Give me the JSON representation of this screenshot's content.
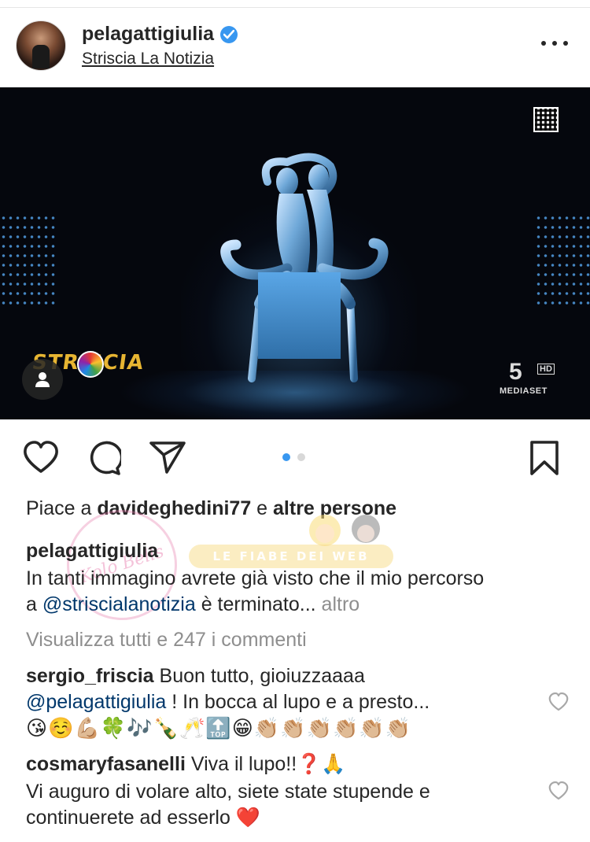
{
  "header": {
    "username": "pelagattigiulia",
    "location": "Striscia La Notizia",
    "verified": true
  },
  "media": {
    "carousel_total": 2,
    "carousel_active": 1,
    "overlay_logo": "STRISCIA",
    "broadcaster_logo": "5",
    "broadcaster_hd": "HD",
    "broadcaster_name": "MEDIASET"
  },
  "likes": {
    "prefix": "Piace a ",
    "user": "davideghedini77",
    "middle": " e ",
    "others": "altre persone"
  },
  "caption": {
    "user": "pelagattigiulia",
    "line1": "In tanti immagino avrete già visto che il mio percorso",
    "line2_prefix": "a ",
    "mention": "@striscialanotizia",
    "line2_suffix": " è terminato... ",
    "more": "altro"
  },
  "view_all_comments": "Visualizza tutti e 247 i commenti",
  "comments": [
    {
      "user": "sergio_friscia",
      "text1": " Buon tutto, gioiuzzaaaa",
      "mention": "@pelagattigiulia",
      "text2": " ! In bocca al lupo e a presto...",
      "emoji_line": "😘☺️💪🏼🍀🎶🍾🥂🔝😁👏🏼👏🏼👏🏼👏🏼👏🏼👏🏼"
    },
    {
      "user": "cosmaryfasanelli",
      "text1": " Viva il lupo!!",
      "text1_emoji": "❓🙏",
      "line2": "Vi auguro di volare alto, siete state stupende e",
      "line3": "continuerete ad esserlo ",
      "line3_emoji": "❤️"
    }
  ],
  "watermark": {
    "circle_text": "Kolo Bells",
    "banner_text": "LE FIABE DEI WEB"
  },
  "icons": {
    "verified": "verified-badge-icon",
    "more": "more-options-icon",
    "tag": "tagged-user-icon",
    "like": "heart-icon",
    "comment": "comment-bubble-icon",
    "share": "paper-plane-icon",
    "save": "bookmark-icon"
  },
  "colors": {
    "link": "#00376b",
    "verified": "#3897f0",
    "muted": "#8e8e8e",
    "carousel_active": "#3897f0"
  }
}
